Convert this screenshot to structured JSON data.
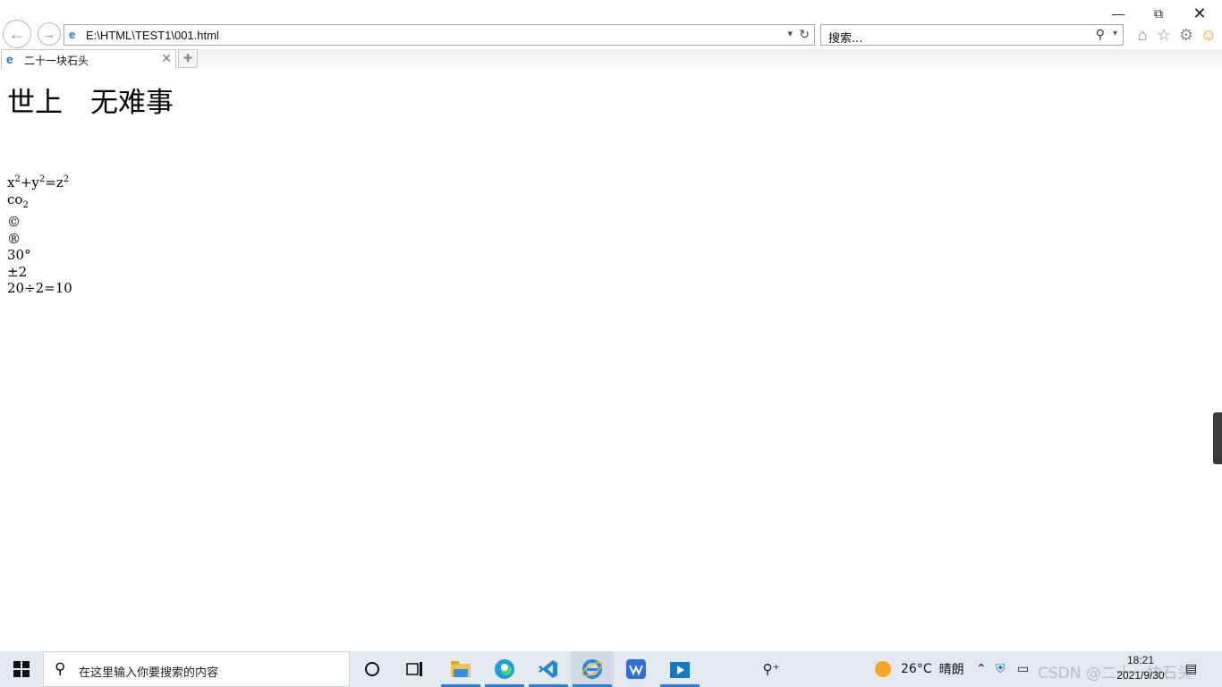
{
  "browser": {
    "address": "E:\\HTML\\TEST1\\001.html",
    "search_placeholder": "搜索...",
    "tab_title": "二十一块石头"
  },
  "page": {
    "heading": "世上　无难事",
    "lines": [
      {
        "parts": [
          "x",
          "2",
          "+y",
          "2",
          "=z",
          "2"
        ]
      },
      {
        "text": "co",
        "sub": "2"
      },
      {
        "text": "©"
      },
      {
        "text": "®"
      },
      {
        "text": "30°"
      },
      {
        "text": "±2"
      },
      {
        "text": "20÷2=10"
      }
    ]
  },
  "taskbar": {
    "search_placeholder": "在这里输入你要搜索的内容",
    "weather_temp": "26°C",
    "weather_text": "晴朗",
    "clock_time": "18:21",
    "clock_date": "2021/9/30",
    "watermark": "CSDN @二十一块石头"
  }
}
